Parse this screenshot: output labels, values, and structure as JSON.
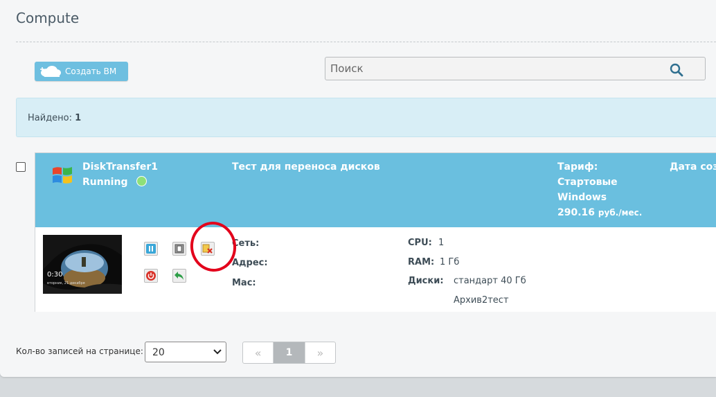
{
  "page": {
    "title": "Compute"
  },
  "toolbar": {
    "create_label": "Создать ВМ"
  },
  "search": {
    "placeholder": "Поиск",
    "value": ""
  },
  "found": {
    "label": "Найдено:",
    "count": "1"
  },
  "vm": {
    "name": "DiskTransfer1",
    "status": "Running",
    "status_color": "#8ee07a",
    "description": "Тест для переноса дисков",
    "tariff_label": "Тариф:",
    "tariff_name_line1": "Стартовые",
    "tariff_name_line2": "Windows",
    "price": "290.16",
    "price_unit": "руб./мес.",
    "date_label": "Дата соз",
    "thumbnail": {
      "time": "0:30",
      "date": "вторник, 21 декабря"
    },
    "actions": [
      {
        "icon": "pause-icon"
      },
      {
        "icon": "console-icon"
      },
      {
        "icon": "delete-icon"
      },
      {
        "icon": "power-icon"
      },
      {
        "icon": "reply-icon"
      }
    ],
    "details": {
      "network_label": "Сеть:",
      "address_label": "Адрес:",
      "mac_label": "Mac:",
      "cpu_label": "CPU:",
      "cpu_value": "1",
      "ram_label": "RAM:",
      "ram_value": "1 Гб",
      "disks_label": "Диски:",
      "disks": [
        "стандарт 40 Гб",
        "Архив2тест"
      ]
    }
  },
  "pagination": {
    "per_page_label": "Кол-во записей на странице:",
    "per_page_value": "20",
    "prev": "«",
    "current": "1",
    "next": "»"
  },
  "colors": {
    "header": "#6abfdf",
    "accent": "#6ebfe0",
    "found_bg": "#d8eef6",
    "annotation": "#e3001b"
  }
}
